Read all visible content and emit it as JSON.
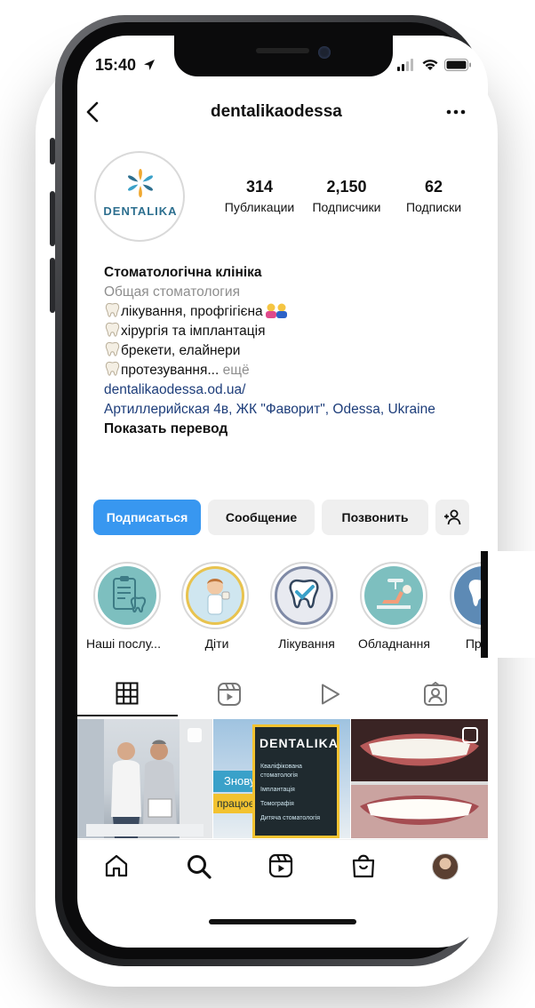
{
  "status_bar": {
    "time": "15:40"
  },
  "header": {
    "username": "dentalikaodessa"
  },
  "profile": {
    "avatar_text": "DENTALIKA",
    "stats": [
      {
        "value": "314",
        "label": "Публикации"
      },
      {
        "value": "2,150",
        "label": "Подписчики"
      },
      {
        "value": "62",
        "label": "Подписки"
      }
    ]
  },
  "bio": {
    "name": "Стоматологічна клініка",
    "category": "Общая стоматология",
    "line1": "лікування, профгігієна",
    "line2": "хірургія та імплантація",
    "line3": "брекети, елайнери",
    "line4": "протезування...",
    "more": " ещё",
    "website": "dentalikaodessa.od.ua/",
    "address": "Артиллерийская 4в, ЖК \"Фаворит\", Odessa, Ukraine",
    "translate": "Показать перевод"
  },
  "actions": {
    "follow": "Подписаться",
    "message": "Сообщение",
    "call": "Позвонить"
  },
  "highlights": [
    {
      "label": "Наші послу..."
    },
    {
      "label": "Діти"
    },
    {
      "label": "Лікування"
    },
    {
      "label": "Обладнання"
    },
    {
      "label": "Профг"
    }
  ],
  "posts": {
    "post2_caption_1": "Знову",
    "post2_caption_2": "працюємо",
    "post2_brand": "DENTALIKA",
    "post2_menu": [
      "Кваліфікована стоматологія",
      "Імплантація",
      "Томографія",
      "Дитяча стоматологія"
    ]
  },
  "colors": {
    "accent": "#3897f0",
    "link": "#1d3d7a",
    "brand": "#2d6f8f"
  }
}
